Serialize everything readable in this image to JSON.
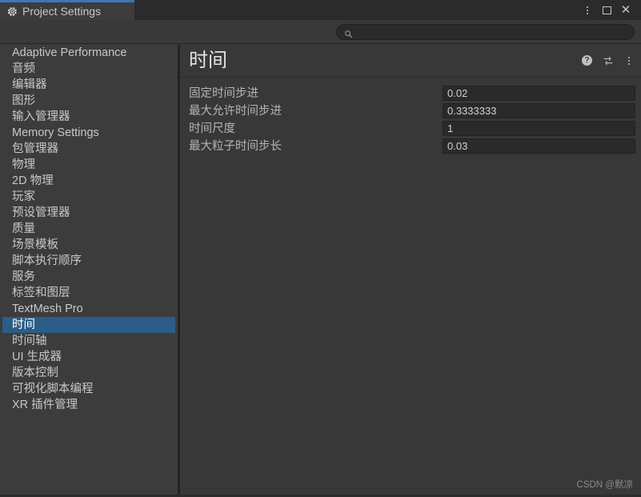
{
  "window": {
    "tab_label": "Project Settings",
    "tab_icon": "gear-icon",
    "controls": {
      "more_icon": "kebab-menu-icon",
      "maximize_icon": "maximize-icon",
      "close_icon": "close-icon",
      "close_glyph": "✕"
    },
    "accent_color": "#3a79b8"
  },
  "search": {
    "icon": "search-icon",
    "value": "",
    "placeholder": ""
  },
  "sidebar": {
    "items": [
      {
        "label": "Adaptive Performance",
        "selected": false
      },
      {
        "label": "音频",
        "selected": false
      },
      {
        "label": "编辑器",
        "selected": false
      },
      {
        "label": "图形",
        "selected": false
      },
      {
        "label": "输入管理器",
        "selected": false
      },
      {
        "label": "Memory Settings",
        "selected": false
      },
      {
        "label": "包管理器",
        "selected": false
      },
      {
        "label": "物理",
        "selected": false
      },
      {
        "label": "2D 物理",
        "selected": false
      },
      {
        "label": "玩家",
        "selected": false
      },
      {
        "label": "预设管理器",
        "selected": false
      },
      {
        "label": "质量",
        "selected": false
      },
      {
        "label": "场景模板",
        "selected": false
      },
      {
        "label": "脚本执行顺序",
        "selected": false
      },
      {
        "label": "服务",
        "selected": false
      },
      {
        "label": "标签和图层",
        "selected": false
      },
      {
        "label": "TextMesh Pro",
        "selected": false
      },
      {
        "label": "时间",
        "selected": true
      },
      {
        "label": "时间轴",
        "selected": false
      },
      {
        "label": "UI 生成器",
        "selected": false
      },
      {
        "label": "版本控制",
        "selected": false
      },
      {
        "label": "可视化脚本编程",
        "selected": false
      },
      {
        "label": "XR 插件管理",
        "selected": false
      }
    ],
    "selected_color": "#2c5d87"
  },
  "panel": {
    "title": "时间",
    "help_icon": "help-icon",
    "preset_icon": "preset-settings-icon",
    "menu_icon": "kebab-menu-icon",
    "fields": [
      {
        "label": "固定时间步进",
        "value": "0.02"
      },
      {
        "label": "最大允许时间步进",
        "value": "0.3333333"
      },
      {
        "label": "时间尺度",
        "value": "1"
      },
      {
        "label": "最大粒子时间步长",
        "value": "0.03"
      }
    ]
  },
  "watermark": {
    "text": "CSDN @默凉"
  }
}
